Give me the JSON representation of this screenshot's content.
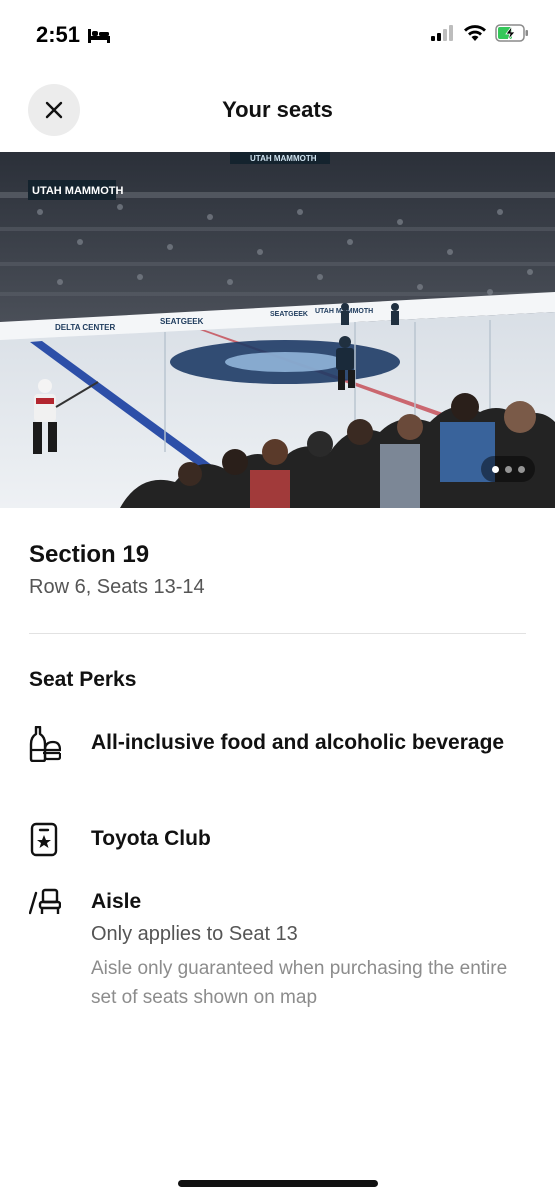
{
  "status_bar": {
    "time": "2:51",
    "icons": [
      "bed-icon",
      "cellular-signal-icon",
      "wifi-icon",
      "battery-charging-icon"
    ]
  },
  "header": {
    "title": "Your seats",
    "close_icon": "close-icon"
  },
  "gallery": {
    "total_images": 3,
    "active_index": 0,
    "arena_signage": {
      "banner_top": "UTAH MAMMOTH",
      "banner_side": "UTAH MAMMOTH",
      "board_center": "DELTA CENTER",
      "board_sponsor": "SEATGEEK",
      "board_sponsor_2": "SEATGEEK",
      "board_text": "UTAH MAMMOTH"
    }
  },
  "section": {
    "title": "Section 19",
    "subtitle": "Row 6, Seats 13-14"
  },
  "perks": {
    "title": "Seat Perks",
    "items": [
      {
        "icon": "food-beverage-icon",
        "label": "All-inclusive food and alcoholic beverage"
      },
      {
        "icon": "club-badge-icon",
        "label": "Toyota Club"
      },
      {
        "icon": "aisle-seat-icon",
        "label": "Aisle",
        "sub": "Only applies to Seat 13",
        "note": "Aisle only guaranteed when purchasing the entire set of seats shown on map"
      }
    ]
  },
  "colors": {
    "text_primary": "#111111",
    "text_secondary": "#555555",
    "text_muted": "#8c8c8c",
    "close_button_bg": "#ececec",
    "divider": "#e2e2e2"
  }
}
